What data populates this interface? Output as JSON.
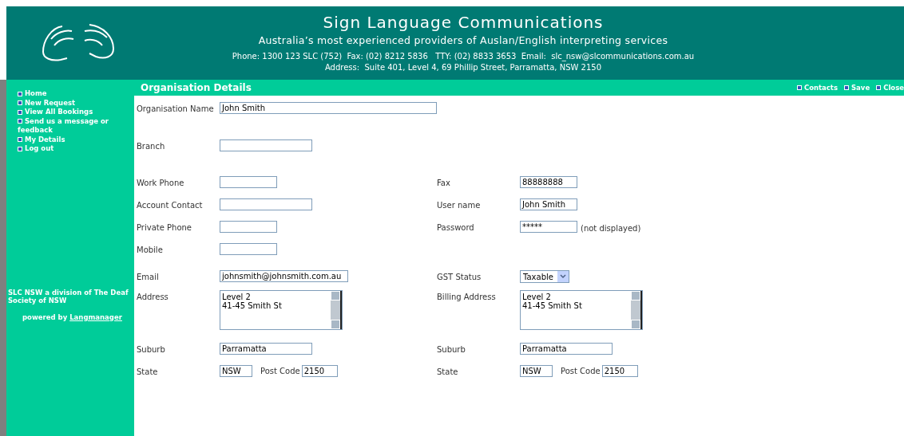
{
  "header": {
    "title": "Sign Language Communications",
    "tagline": "Australia’s most experienced providers of Auslan/English interpreting services",
    "contact": "Phone: 1300 123 SLC (752)  Fax: (02) 8212 5836   TTY: (02) 8833 3653  Email:  slc_nsw@slcommunications.com.au",
    "address": "Address:  Suite 401, Level 4, 69 Phillip Street, Parramatta, NSW 2150"
  },
  "sidebar": {
    "items": [
      {
        "label": "Home"
      },
      {
        "label": "New Request"
      },
      {
        "label": "View All Bookings"
      },
      {
        "label": "Send us a message or feedback"
      },
      {
        "label": "My Details"
      },
      {
        "label": "Log out"
      }
    ],
    "footer": "SLC NSW a division of The Deaf Society of NSW",
    "powered_by": "powered by",
    "powered_link": "Langmanager"
  },
  "page_title": "Organisation Details",
  "actions": [
    "Contacts",
    "Save",
    "Close"
  ],
  "rows": [
    {
      "left": {
        "label": "Organisation Name",
        "kind": "long",
        "value": "John Smith"
      }
    },
    {
      "left": {
        "label": "Branch",
        "kind": "medium"
      }
    },
    {
      "left": {
        "label": "Work Phone",
        "kind": "short"
      },
      "right": {
        "label": "Fax",
        "kind": "short",
        "value": "88888888"
      }
    },
    {
      "left": {
        "label": "Account Contact",
        "kind": "medium"
      },
      "right": {
        "label": "User name",
        "kind": "short",
        "value": "John Smith"
      }
    },
    {
      "left": {
        "label": "Private Phone",
        "kind": "short"
      },
      "right": {
        "label": "Password",
        "kind": "short",
        "value": "*****",
        "note": "(not displayed)"
      }
    },
    {
      "left": {
        "label": "Mobile",
        "kind": "short"
      }
    },
    {
      "left": {
        "label": "Email",
        "kind": "email",
        "value": "johnsmith@johnsmith.com.au"
      },
      "right": {
        "label": "GST Status",
        "kind": "select",
        "value": "Taxable"
      }
    },
    {
      "left": {
        "label": "Address",
        "kind": "textarea",
        "value": "Level 2\n41-45 Smith St"
      },
      "right": {
        "label": "Billing Address",
        "kind": "textarea",
        "value": "Level 2\n41-45 Smith St"
      }
    },
    {
      "left": {
        "label": "Suburb",
        "kind": "medium",
        "value": "Parramatta"
      },
      "right": {
        "label": "Suburb",
        "kind": "medium",
        "value": "Parramatta"
      }
    },
    {
      "left": {
        "label": "State",
        "kind": "state",
        "value": "NSW",
        "post_label": "Post Code",
        "post_value": "2150"
      },
      "right": {
        "label": "State",
        "kind": "state",
        "value": "NSW",
        "post_label": "Post Code",
        "post_value": "2150"
      }
    }
  ]
}
